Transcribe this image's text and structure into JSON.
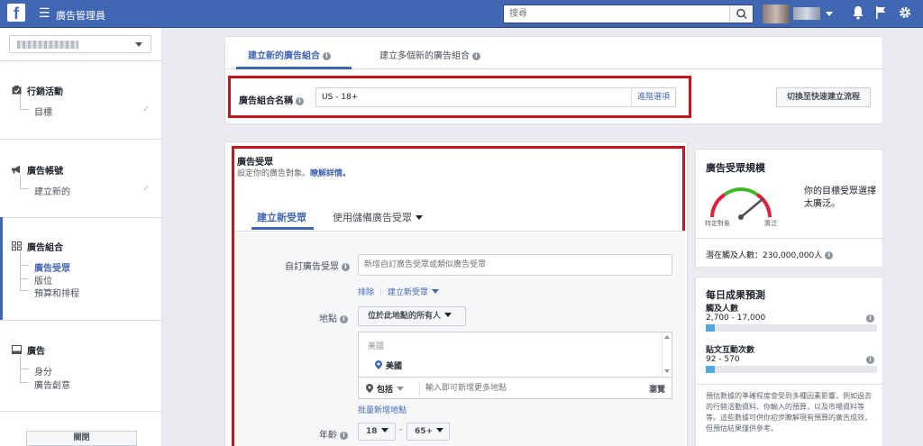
{
  "topbar": {
    "logo": "f",
    "menu_glyph": "☰",
    "app_title": "廣告管理員",
    "search_placeholder": "搜尋",
    "icons": [
      "search-icon",
      "notifications-icon",
      "flag-icon",
      "settings-icon"
    ]
  },
  "sidebar": {
    "sections": [
      {
        "title": "行銷活動",
        "icon": "campaign-icon",
        "items": [
          {
            "label": "目標",
            "checked": true
          }
        ]
      },
      {
        "title": "廣告帳號",
        "icon": "megaphone-icon",
        "items": [
          {
            "label": "建立新的",
            "checked": true
          }
        ]
      },
      {
        "title": "廣告組合",
        "icon": "adset-grid-icon",
        "items": [
          {
            "label": "廣告受眾",
            "active": true
          },
          {
            "label": "版位"
          },
          {
            "label": "預算和排程"
          }
        ]
      },
      {
        "title": "廣告",
        "icon": "ad-icon",
        "items": [
          {
            "label": "身分"
          },
          {
            "label": "廣告創意"
          }
        ]
      }
    ],
    "close_button": "關閉"
  },
  "adset_card": {
    "tabs": [
      "建立新的廣告組合",
      "建立多個新的廣告組合"
    ],
    "name_label": "廣告組合名稱",
    "name_value": "US - 18+",
    "advanced_link": "進階選項",
    "switch_button": "切換至快速建立流程"
  },
  "audience_card": {
    "title": "廣告受眾",
    "subtitle": "設定你的廣告對象。",
    "learn_more": "瞭解詳情。",
    "tabs": [
      "建立新受眾",
      "使用儲備廣告受眾"
    ],
    "custom_audience_label": "自訂廣告受眾",
    "custom_audience_placeholder": "新增自訂廣告受眾或類似廣告受眾",
    "exclude_link": "排除",
    "create_new_link": "建立新受眾",
    "location_label": "地點",
    "location_dropdown": "位於此地點的所有人",
    "location_group": "美國",
    "location_item": "美國",
    "include_dropdown": "包括",
    "location_search_placeholder": "輸入即可新增更多地點",
    "browse_link": "瀏覽",
    "bulk_add_link": "批量新增地點",
    "age_label": "年齡",
    "age_min": "18",
    "age_separator": "-",
    "age_max": "65+"
  },
  "audience_size": {
    "title": "廣告受眾規模",
    "gauge_left": "特定對象",
    "gauge_right": "廣泛",
    "description": "你的目標受眾選擇太廣泛。",
    "potential_reach_label": "潛在觸及人數：230,000,000人"
  },
  "daily_results": {
    "title": "每日成果預測",
    "metrics": [
      {
        "label": "觸及人數",
        "value": "2,700 - 17,000",
        "fill": 0.05
      },
      {
        "label": "貼文互動次數",
        "value": "92 - 570",
        "fill": 0.05
      }
    ],
    "disclaimer": "預估數據的準確程度會受到多種因素影響，例如過去的行銷活動資料、你輸入的預算，以及市場資料等等。這些數據可供你初步瞭解現有預算的廣告成效，但預估結果僅供參考。"
  },
  "colors": {
    "brand": "#4267b2",
    "highlight_border": "#c4161c",
    "reach_bar": "#51a8dd",
    "gauge_needle": "#4b4f56"
  }
}
